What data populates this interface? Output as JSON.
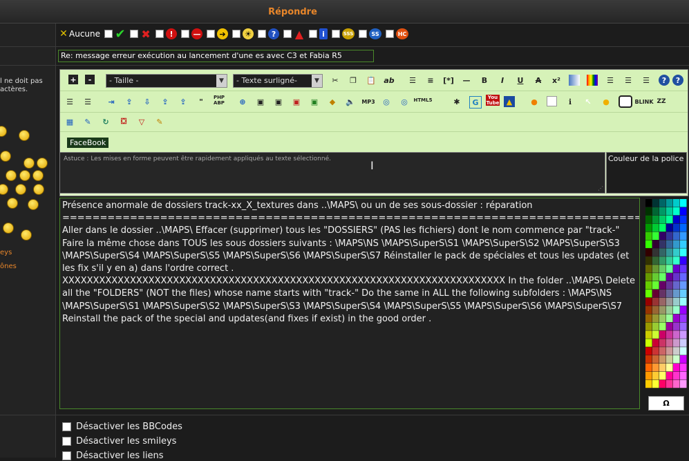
{
  "header": {
    "title": "Répondre"
  },
  "left": {
    "notice": "l ne doit pas actères.",
    "link1": "eys",
    "link2": "ônes"
  },
  "icons": {
    "none_label": "Aucune"
  },
  "subject": {
    "value": "Re: message erreur exécution au lancement d'une es avec C3 et Fabia R5"
  },
  "toolbar": {
    "size_select": "- Taille -",
    "highlight_select": "- Texte surligné-",
    "facebook": "FaceBook",
    "php": "PHP ABP",
    "html": "HTML5",
    "youtube": "You Tube",
    "blink": "BLINK"
  },
  "hint": {
    "text": "Astuce : Les mises en forme peuvent être rapidement appliqués au texte sélectionné."
  },
  "color_font": {
    "label": "Couleur de la police"
  },
  "message": {
    "text": "Présence anormale de dossiers track-xx_X_textures dans ..\\MAPS\\ ou un de ses sous-dossier : réparation\n===============================================================================\nAller dans le dossier ..\\MAPS\\ Effacer (supprimer) tous les \"DOSSIERS\" (PAS les fichiers) dont le nom commence par \"track-\"\nFaire la même chose dans TOUS les sous dossiers suivants : \\MAPS\\NS \\MAPS\\SuperS\\S1 \\MAPS\\SuperS\\S2 \\MAPS\\SuperS\\S3 \\MAPS\\SuperS\\S4 \\MAPS\\SuperS\\S5 \\MAPS\\SuperS\\S6 \\MAPS\\SuperS\\S7 Réinstaller le pack de spéciales et tous les updates (et les fix s'il y en a) dans l'ordre correct .\nXXXXXXXXXXXXXXXXXXXXXXXXXXXXXXXXXXXXXXXXXXXXXXXXXXXXXXXXXXXXXXXXXXXXXXXX In the folder ..\\MAPS\\ Delete all the \"FOLDERS\" (NOT the files) whose name starts with \"track-\" Do the same in ALL the following subfolders : \\MAPS\\NS \\MAPS\\SuperS\\S1 \\MAPS\\SuperS\\S2 \\MAPS\\SuperS\\S3 \\MAPS\\SuperS\\S4 \\MAPS\\SuperS\\S5 \\MAPS\\SuperS\\S6 \\MAPS\\SuperS\\S7 Reinstall the pack of the special and updates(and fixes if exist) in the good order ."
  },
  "omega": "Ω",
  "options": [
    {
      "label": "Désactiver les BBCodes"
    },
    {
      "label": "Désactiver les smileys"
    },
    {
      "label": "Désactiver les liens"
    }
  ]
}
